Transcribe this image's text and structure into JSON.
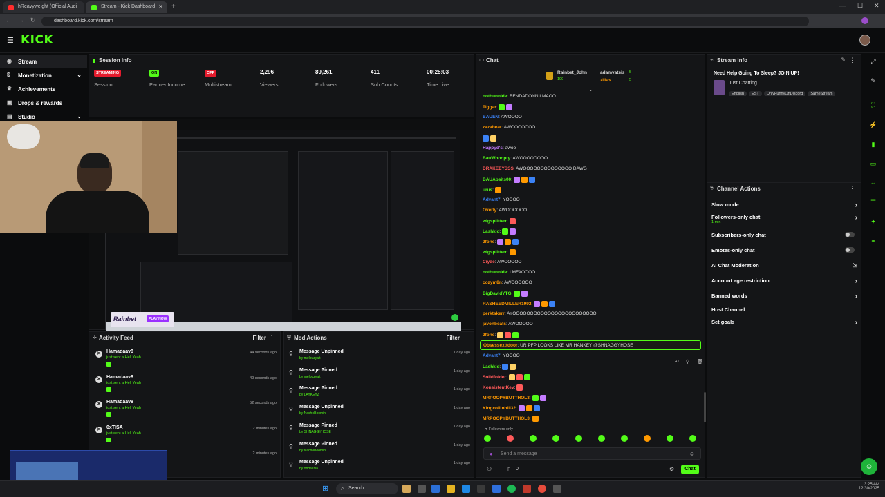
{
  "browser": {
    "tabs": [
      {
        "label": "hReavyweight (Official Audi",
        "color": "#ff2d2d"
      },
      {
        "label": "Stream - Kick Dashboard",
        "color": "#53fc18"
      }
    ],
    "url": "dashboard.kick.com/stream"
  },
  "sidebar": {
    "items": [
      {
        "label": "Stream",
        "icon": "broadcast-icon"
      },
      {
        "label": "Monetization",
        "icon": "dollar-icon"
      },
      {
        "label": "Achievements",
        "icon": "trophy-icon"
      },
      {
        "label": "Drops & rewards",
        "icon": "gift-icon"
      },
      {
        "label": "Studio",
        "icon": "studio-icon"
      }
    ]
  },
  "session": {
    "title": "Session Info",
    "stats": [
      {
        "value": "STREAMING",
        "label": "Session",
        "badge_color": "#e31b2d"
      },
      {
        "value": "ON",
        "label": "Partner Income",
        "badge_color": "#53fc18"
      },
      {
        "value": "OFF",
        "label": "Multistream",
        "badge_color": "#e31b2d"
      },
      {
        "value": "2,296",
        "label": "Viewers"
      },
      {
        "value": "89,261",
        "label": "Followers"
      },
      {
        "value": "411",
        "label": "Sub Counts"
      },
      {
        "value": "00:25:03",
        "label": "Time Live"
      }
    ]
  },
  "preview": {
    "sponsor": "Rainbet",
    "sponsor_cta": "PLAY NOW"
  },
  "activity": {
    "title": "Activity Feed",
    "filter": "Filter",
    "items": [
      {
        "user": "Hamadaav8",
        "text": "just sent a Hell Yeah",
        "time": "44 seconds ago"
      },
      {
        "user": "Hamadaav8",
        "text": "just sent a Hell Yeah",
        "time": "49 seconds ago"
      },
      {
        "user": "Hamadaav8",
        "text": "just sent a Hell Yeah",
        "time": "52 seconds ago"
      },
      {
        "user": "0xTISA",
        "text": "just sent a Hell Yeah",
        "time": "2 minutes ago"
      },
      {
        "user": "",
        "text": "",
        "time": "2 minutes ago"
      }
    ]
  },
  "mod_actions": {
    "title": "Mod Actions",
    "filter": "Filter",
    "items": [
      {
        "action": "Message Unpinned",
        "by": "by melbuzyalt",
        "time": "1 day ago"
      },
      {
        "action": "Message Pinned",
        "by": "by melbuzyalt",
        "time": "1 day ago"
      },
      {
        "action": "Message Pinned",
        "by": "by LAYKEYZ",
        "time": "1 day ago"
      },
      {
        "action": "Message Unpinned",
        "by": "by NachoBoomin",
        "time": "1 day ago"
      },
      {
        "action": "Message Pinned",
        "by": "by SHNAGGYHOSE",
        "time": "1 day ago"
      },
      {
        "action": "Message Pinned",
        "by": "by NachoBoomin",
        "time": "1 day ago"
      },
      {
        "action": "Message Unpinned",
        "by": "by ohdaluva",
        "time": "1 day ago"
      }
    ]
  },
  "chat": {
    "title": "Chat",
    "top_gifters": [
      {
        "name": "Rainbet_John",
        "count": "100"
      },
      {
        "name": "adamvatsis",
        "count": "5"
      },
      {
        "name": "zilias",
        "count": "5"
      }
    ],
    "messages": [
      {
        "user": "nothunnide",
        "text": "BENDADONN LMAOO",
        "color": "#53fc18"
      },
      {
        "user": "Tiggar",
        "text": "",
        "color": "#ff9900"
      },
      {
        "user": "BAUEN",
        "text": "AWOOOO",
        "color": "#3b82f6"
      },
      {
        "user": "zazabear",
        "text": "AWOOOOOOO",
        "color": "#ff9900"
      },
      {
        "user": "",
        "text": "",
        "color": "#ffffff"
      },
      {
        "user": "Happyd's",
        "text": "awoo",
        "color": "#c47cff"
      },
      {
        "user": "BauWhoopty",
        "text": "AWOOOOOOOO",
        "color": "#53fc18"
      },
      {
        "user": "DRAKEEYSSS",
        "text": "AWOOOOOOOOOOOOOO DAWG",
        "color": "#ff5a5a"
      },
      {
        "user": "BAUAbsits00",
        "text": "",
        "color": "#53fc18"
      },
      {
        "user": "urus",
        "text": "",
        "color": "#53fc18"
      },
      {
        "user": "Advant7",
        "text": "YOOOO",
        "color": "#3b82f6"
      },
      {
        "user": "Overly",
        "text": "AWOOOOOO",
        "color": "#ff9900"
      },
      {
        "user": "wigsplitterr",
        "text": "",
        "color": "#53fc18"
      },
      {
        "user": "Lashkid",
        "text": "",
        "color": "#53fc18"
      },
      {
        "user": "2fone",
        "text": "",
        "color": "#ff9900"
      },
      {
        "user": "wigsplitterr",
        "text": "",
        "color": "#53fc18"
      },
      {
        "user": "Ciyde",
        "text": "AWOOOOO",
        "color": "#ff5a5a"
      },
      {
        "user": "nothunnide",
        "text": "LMFAOOOO",
        "color": "#53fc18"
      },
      {
        "user": "cozym8n",
        "text": "AWOOOOOO",
        "color": "#ff9900"
      },
      {
        "user": "BigDavidYTG",
        "text": "",
        "color": "#53fc18"
      },
      {
        "user": "RASHEEDMILLER1992",
        "text": "",
        "color": "#ff9900"
      },
      {
        "user": "perktakerr",
        "text": "AYOOOOOOOOOOOOOOOOOOOOOOOO",
        "color": "#ff9900"
      },
      {
        "user": "javonbeats",
        "text": "AWOOOOO",
        "color": "#ff9900"
      },
      {
        "user": "2fone",
        "text": "",
        "color": "#ff9900"
      }
    ],
    "highlighted": {
      "user": "Obsessexttdoor",
      "text": "UR PFP LOOKS LIKE MR HANKEY @SHNAGGYHOSE"
    },
    "messages_after": [
      {
        "user": "Advant7",
        "text": "YOOOO",
        "color": "#3b82f6"
      },
      {
        "user": "Lashkid",
        "text": "",
        "color": "#53fc18"
      },
      {
        "user": "Solidfolder",
        "text": "",
        "color": "#ff5a5a"
      },
      {
        "user": "KonsistentKev",
        "text": "",
        "color": "#ff5a5a"
      },
      {
        "user": "MRPOOPYBUTTHOL3",
        "text": "",
        "color": "#ff9900"
      },
      {
        "user": "Kingcolllnhill32",
        "text": "",
        "color": "#ff9900"
      },
      {
        "user": "MRPOOPYBUTTHOL3",
        "text": "",
        "color": "#ff9900"
      }
    ],
    "mode_label": "Followers only",
    "input_placeholder": "Send a message",
    "counter": "0",
    "send_label": "Chat"
  },
  "stream_info": {
    "title": "Stream Info",
    "stream_title": "Need Help Going To Sleep? JOIN UP!",
    "category": "Just Chatting",
    "tags": [
      "English",
      "EST",
      "OnlyFunnyOnDiscord",
      "SameStream"
    ]
  },
  "channel_actions": {
    "title": "Channel Actions",
    "items": [
      {
        "label": "Slow mode",
        "control": "chevron",
        "sub": ""
      },
      {
        "label": "Followers-only chat",
        "control": "chevron",
        "sub": "1 min"
      },
      {
        "label": "Subscribers-only chat",
        "control": "toggle",
        "sub": ""
      },
      {
        "label": "Emotes-only chat",
        "control": "toggle",
        "sub": ""
      },
      {
        "label": "AI Chat Moderation",
        "control": "external",
        "sub": ""
      },
      {
        "label": "Account age restriction",
        "control": "chevron",
        "sub": ""
      },
      {
        "label": "Banned words",
        "control": "chevron",
        "sub": ""
      },
      {
        "label": "Host Channel",
        "control": "none",
        "sub": ""
      },
      {
        "label": "Set goals",
        "control": "chevron",
        "sub": ""
      }
    ]
  },
  "taskbar": {
    "search": "Search",
    "time": "3:25 AM",
    "date": "12/30/2025"
  }
}
